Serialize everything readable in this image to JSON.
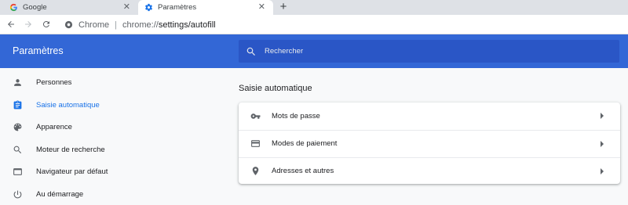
{
  "tabs": [
    {
      "title": "Google",
      "icon": "google-g-icon",
      "active": false
    },
    {
      "title": "Paramètres",
      "icon": "settings-gear-icon",
      "active": true
    }
  ],
  "toolbar": {
    "site_chip": "Chrome",
    "url_scheme": "chrome://",
    "url_path": "settings/autofill"
  },
  "header": {
    "title": "Paramètres",
    "search_placeholder": "Rechercher"
  },
  "sidebar": {
    "items": [
      {
        "label": "Personnes",
        "icon": "person-icon"
      },
      {
        "label": "Saisie automatique",
        "icon": "clipboard-icon",
        "selected": true
      },
      {
        "label": "Apparence",
        "icon": "palette-icon"
      },
      {
        "label": "Moteur de recherche",
        "icon": "search-icon"
      },
      {
        "label": "Navigateur par défaut",
        "icon": "browser-window-icon"
      },
      {
        "label": "Au démarrage",
        "icon": "power-icon"
      }
    ]
  },
  "main": {
    "section_title": "Saisie automatique",
    "rows": [
      {
        "label": "Mots de passe",
        "icon": "key-icon"
      },
      {
        "label": "Modes de paiement",
        "icon": "credit-card-icon"
      },
      {
        "label": "Adresses et autres",
        "icon": "location-pin-icon"
      }
    ]
  },
  "colors": {
    "header_blue": "#3367d6",
    "search_blue": "#2a56c6",
    "accent": "#1a73e8"
  }
}
